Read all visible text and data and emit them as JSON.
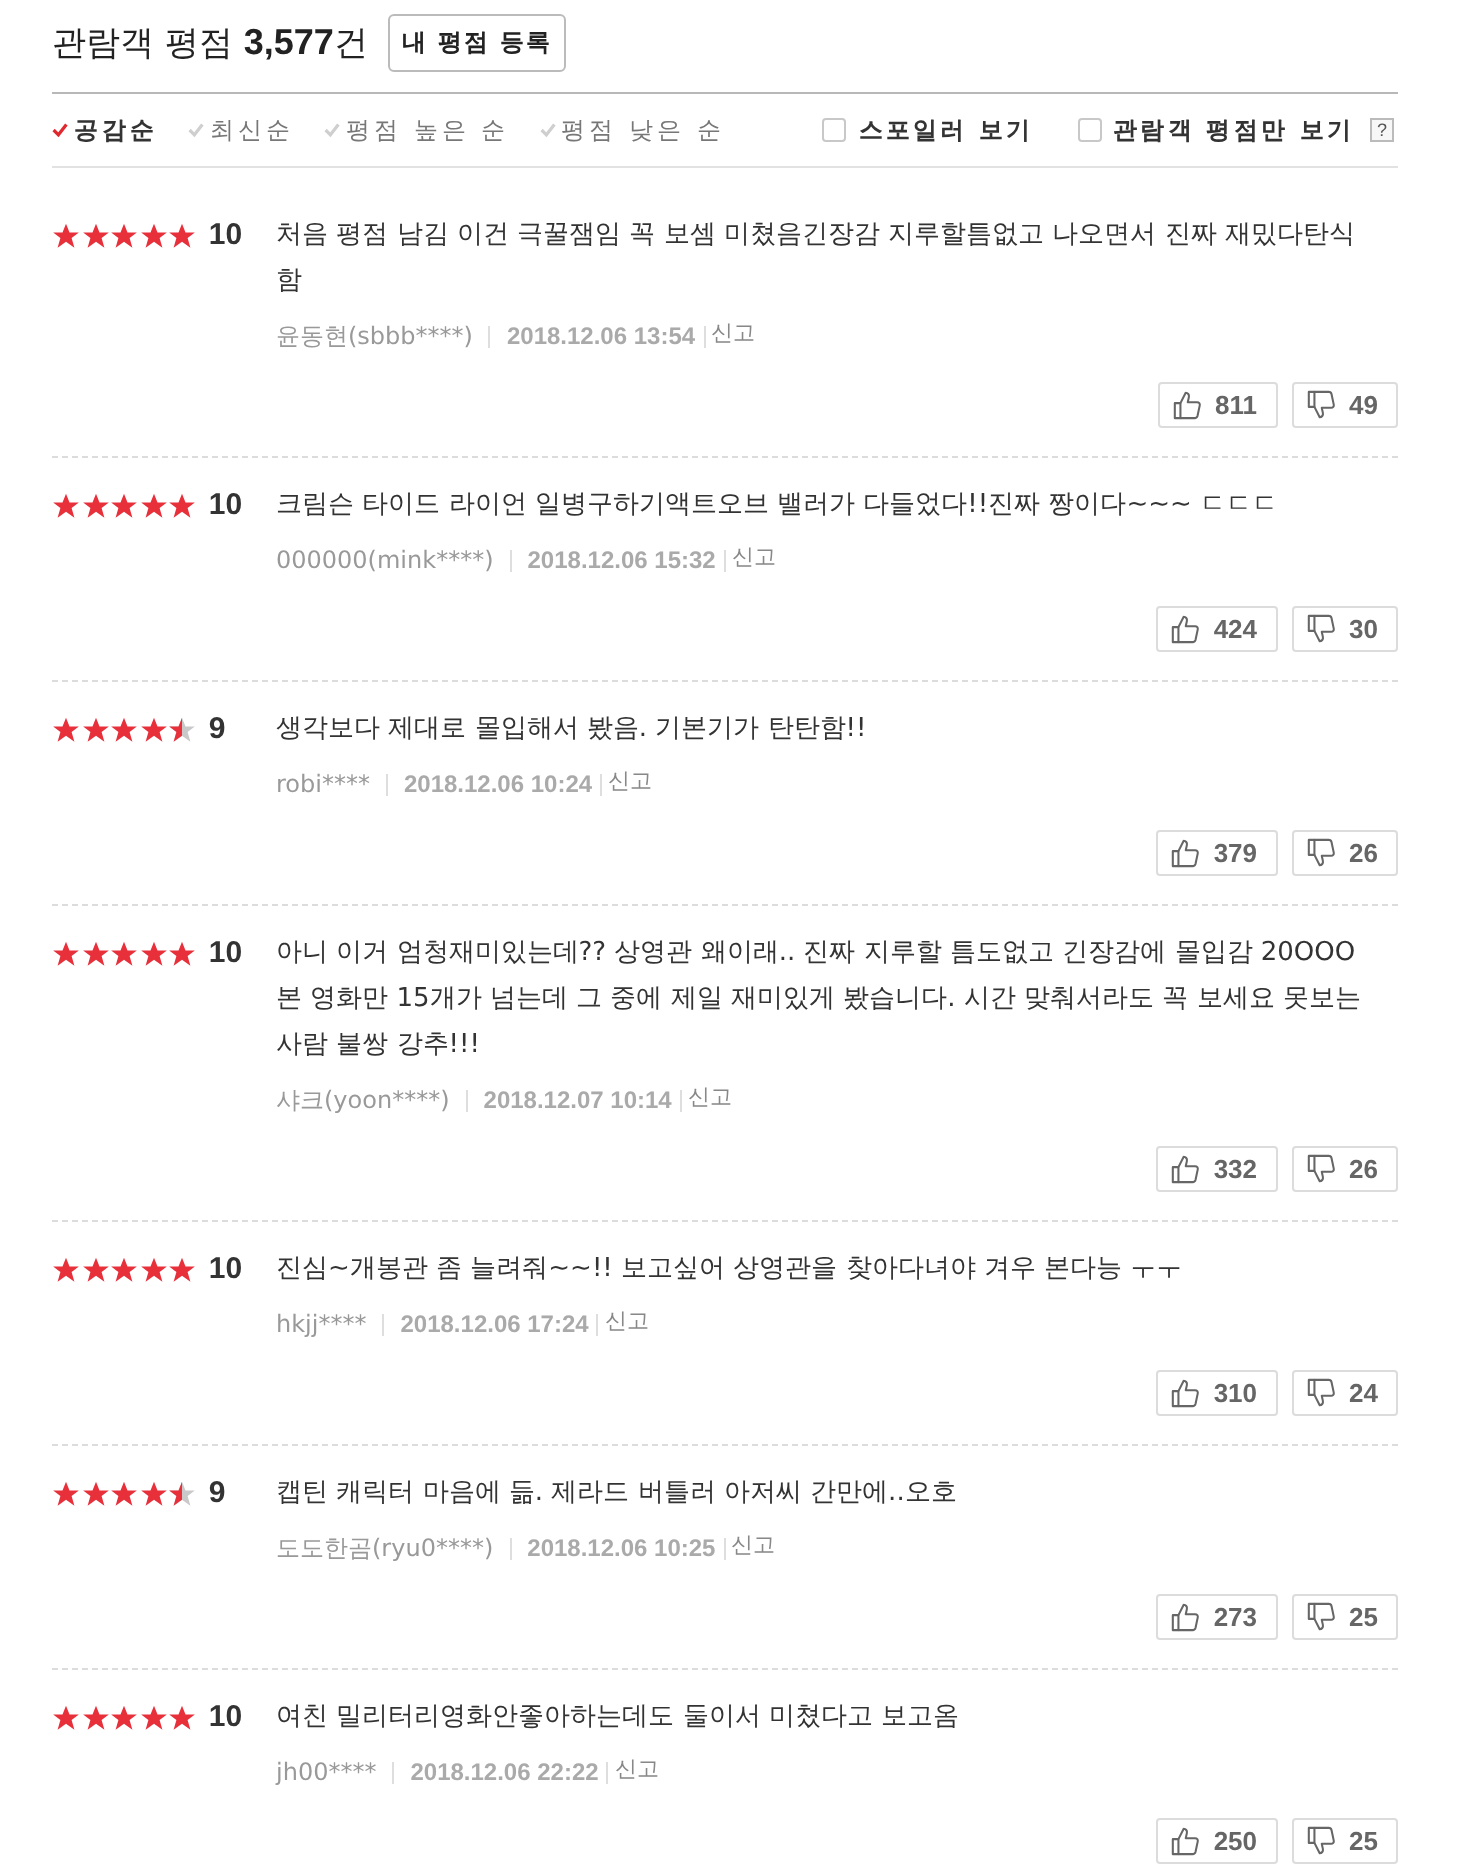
{
  "header": {
    "title": "관람객 평점 **3,577**건",
    "register_button": "내 평점 등록"
  },
  "sort_options": [
    {
      "label": "공감순",
      "selected": true
    },
    {
      "label": "최신순",
      "selected": false
    },
    {
      "label": "평점 높은 순",
      "selected": false
    },
    {
      "label": "평점 낮은 순",
      "selected": false
    }
  ],
  "filters": [
    {
      "label": "스포일러 보기",
      "checked": false
    },
    {
      "label": "관람객 평점만 보기",
      "checked": false
    }
  ],
  "help_button": "?",
  "reviews": [
    {
      "stars": 5,
      "score": "10",
      "text": "처음 평점 남김 이건 극꿀잼임 꼭 보셈 미쳤음긴장감 지루할틈없고 나오면서 진짜 재밌다탄식함",
      "author": "윤동현(sbbb****)",
      "date": "2018.12.06 13:54",
      "report": "신고",
      "likes": "811",
      "dislikes": "49"
    },
    {
      "stars": 5,
      "score": "10",
      "text": "크림슨 타이드 라이언 일병구하기액트오브 밸러가 다들었다!!진짜 짱이다~~~ ㄷㄷㄷ",
      "author": "000000(mink****)",
      "date": "2018.12.06 15:32",
      "report": "신고",
      "likes": "424",
      "dislikes": "30"
    },
    {
      "stars": 4.5,
      "score": "9",
      "text": "생각보다 제대로 몰입해서 봤음. 기본기가 탄탄함!!",
      "author": "robi****",
      "date": "2018.12.06 10:24",
      "report": "신고",
      "likes": "379",
      "dislikes": "26"
    },
    {
      "stars": 5,
      "score": "10",
      "text": "아니 이거 엄청재미있는데?? 상영관 왜이래.. 진짜 지루할 틈도없고 긴장감에 몰입감 20OOO 본 영화만 15개가 넘는데 그 중에 제일 재미있게 봤습니다. 시간 맞춰서라도 꼭 보세요 못보는 사람 불쌍 강추!!!",
      "author": "샤크(yoon****)",
      "date": "2018.12.07 10:14",
      "report": "신고",
      "likes": "332",
      "dislikes": "26"
    },
    {
      "stars": 5,
      "score": "10",
      "text": "진심~개봉관 좀 늘려줘~~!! 보고싶어 상영관을 찾아다녀야 겨우 본다능 ㅜㅜ",
      "author": "hkjj****",
      "date": "2018.12.06 17:24",
      "report": "신고",
      "likes": "310",
      "dislikes": "24"
    },
    {
      "stars": 4.5,
      "score": "9",
      "text": "캡틴 캐릭터 마음에 듦. 제라드 버틀러 아저씨 간만에..오호",
      "author": "도도한곰(ryu0****)",
      "date": "2018.12.06 10:25",
      "report": "신고",
      "likes": "273",
      "dislikes": "25"
    },
    {
      "stars": 5,
      "score": "10",
      "text": "여친 밀리터리영화안좋아하는데도 둘이서 미쳤다고 보고옴",
      "author": "jh00****",
      "date": "2018.12.06 22:22",
      "report": "신고",
      "likes": "250",
      "dislikes": "25"
    }
  ]
}
